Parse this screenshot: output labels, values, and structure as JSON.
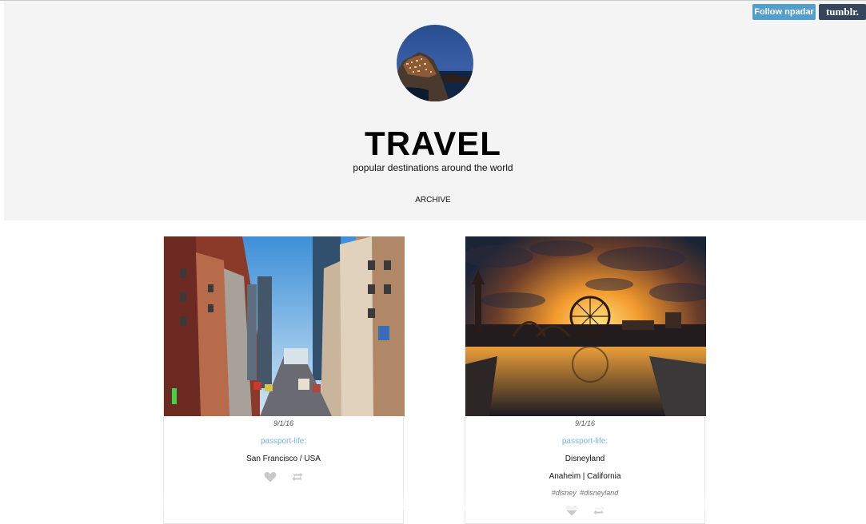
{
  "blog": {
    "title": "TRAVEL",
    "description": "popular destinations around the world",
    "archive_label": "ARCHIVE"
  },
  "toolbar": {
    "follow_label": "Follow npadar",
    "tumblr_label": "tumblr."
  },
  "colors": {
    "header_bg": "#f4f4f4",
    "follow_bg": "#529ecc",
    "tumblr_bg": "#35465c",
    "link": "#7ab7dd"
  },
  "posts": [
    {
      "date": "9/1/16",
      "source": "passport-life",
      "source_suffix": ":",
      "lines": [
        "San Francisco / USA"
      ],
      "tags": [],
      "icons": [
        "heart-icon",
        "reblog-icon"
      ]
    },
    {
      "date": "9/1/16",
      "source": "passport-life",
      "source_suffix": ":",
      "lines": [
        "Disneyland",
        "Anaheim | California"
      ],
      "tags": [
        "#disney",
        "#disneyland"
      ],
      "icons": [
        "heart-icon",
        "reblog-icon"
      ]
    }
  ]
}
